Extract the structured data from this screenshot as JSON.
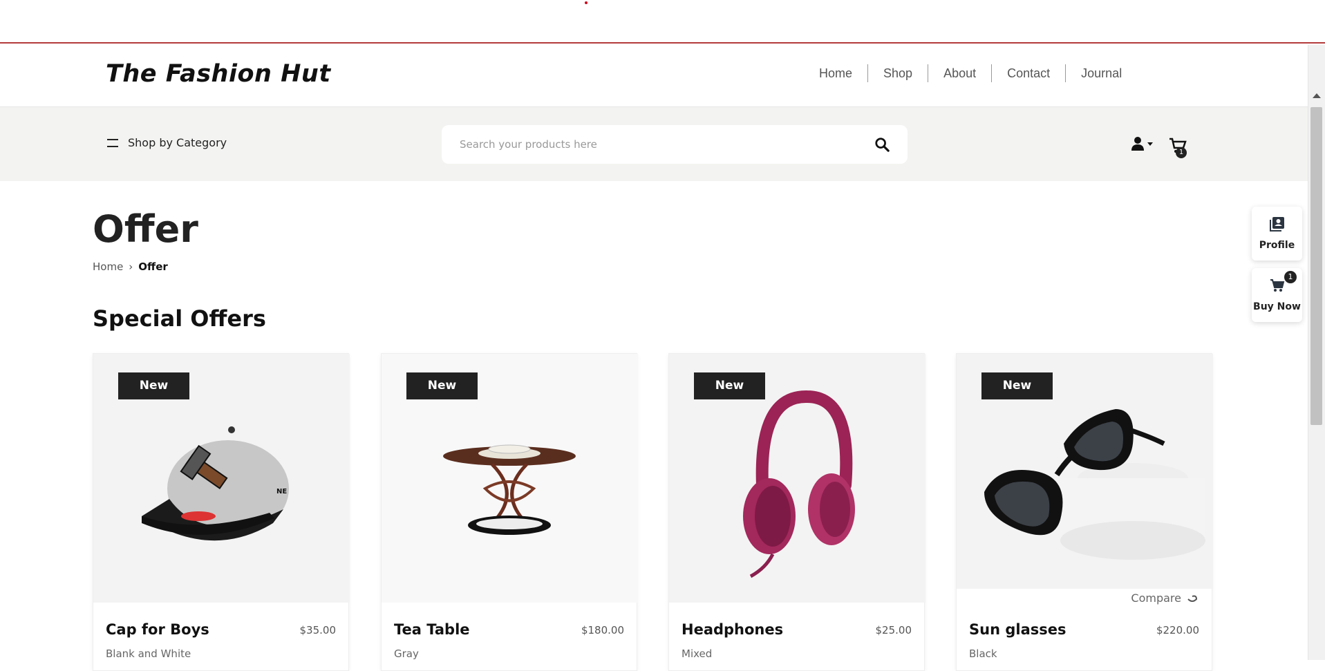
{
  "header": {
    "logo": "The Fashion Hut",
    "nav": [
      "Home",
      "Shop",
      "About",
      "Contact",
      "Journal"
    ]
  },
  "catbar": {
    "shop_by_category": "Shop by Category",
    "search_placeholder": "Search your products here",
    "cart_count": "1"
  },
  "page": {
    "title": "Offer",
    "breadcrumb": {
      "home": "Home",
      "current": "Offer"
    },
    "section_title": "Special Offers"
  },
  "products": [
    {
      "badge": "New",
      "name": "Cap for Boys",
      "price": "$35.00",
      "color": "Blank and White",
      "image": "cap-image"
    },
    {
      "badge": "New",
      "name": "Tea Table",
      "price": "$180.00",
      "color": "Gray",
      "image": "tea-table-image"
    },
    {
      "badge": "New",
      "name": "Headphones",
      "price": "$25.00",
      "color": "Mixed",
      "image": "headphones-image"
    },
    {
      "badge": "New",
      "name": "Sun glasses",
      "price": "$220.00",
      "color": "Black",
      "image": "sunglasses-image",
      "compare": "Compare"
    }
  ],
  "side": {
    "profile_label": "Profile",
    "buy_label": "Buy Now",
    "buy_count": "1"
  }
}
